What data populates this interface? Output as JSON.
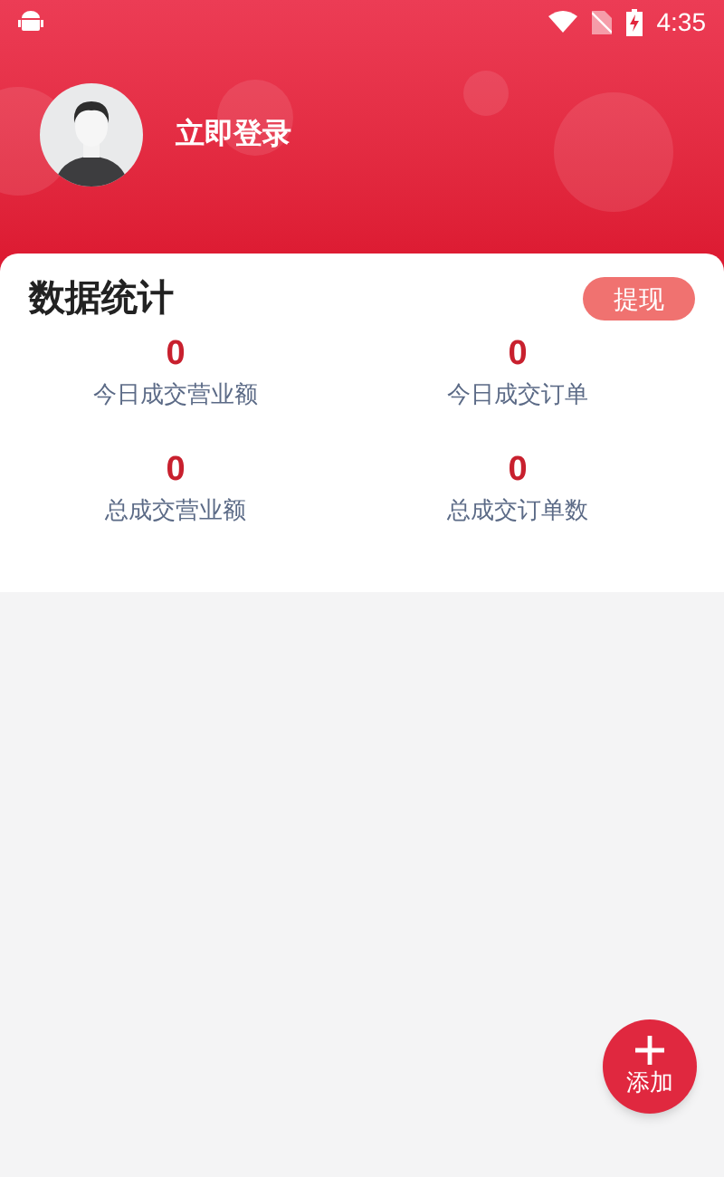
{
  "status_bar": {
    "time": "4:35"
  },
  "profile": {
    "login_label": "立即登录"
  },
  "stats_card": {
    "title": "数据统计",
    "withdraw_button": "提现",
    "stats": [
      {
        "value": "0",
        "label": "今日成交营业额"
      },
      {
        "value": "0",
        "label": "今日成交订单"
      },
      {
        "value": "0",
        "label": "总成交营业额"
      },
      {
        "value": "0",
        "label": "总成交订单数"
      }
    ]
  },
  "fab": {
    "label": "添加"
  }
}
